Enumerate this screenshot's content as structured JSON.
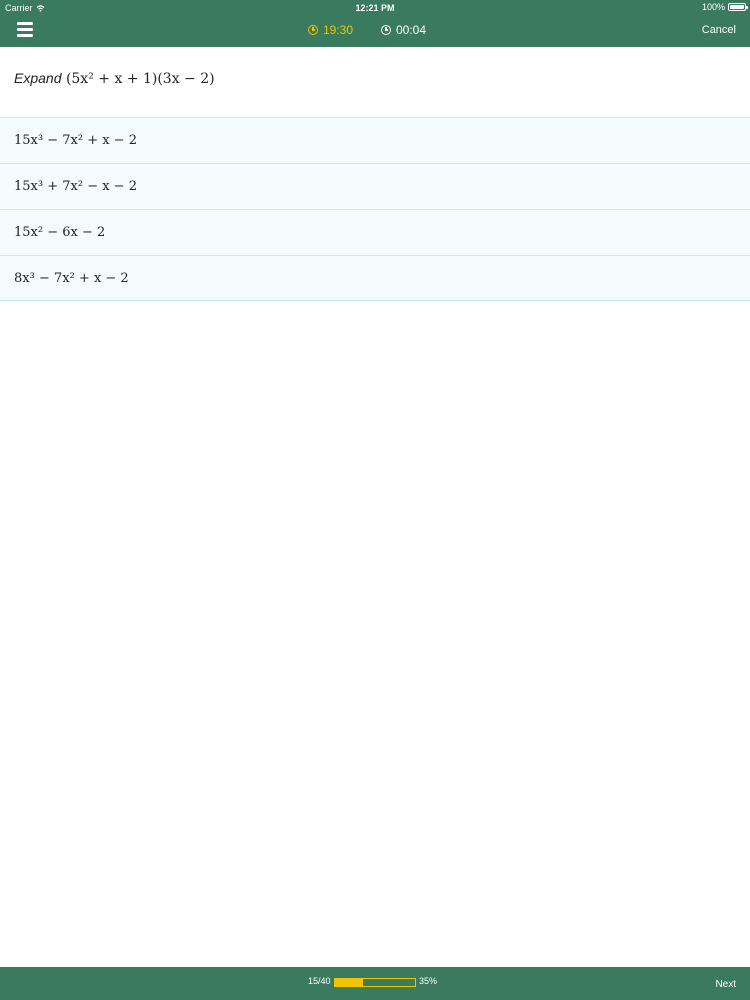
{
  "status_bar": {
    "carrier": "Carrier",
    "time": "12:21 PM",
    "battery": "100%"
  },
  "nav": {
    "menu_icon": "hamburger-menu-icon",
    "timer_remaining": "19:30",
    "timer_elapsed": "00:04",
    "cancel_label": "Cancel",
    "accent_color": "#f2c400",
    "bar_color": "#3a7a5f"
  },
  "question": {
    "label": "Expand",
    "expression": "(5x² + x + 1)(3x − 2)"
  },
  "answers": [
    {
      "expression": "15x³ − 7x² + x − 2"
    },
    {
      "expression": "15x³ + 7x² − x − 2"
    },
    {
      "expression": "15x² − 6x − 2"
    },
    {
      "expression": "8x³ − 7x² + x − 2"
    }
  ],
  "footer": {
    "question_count": "15/40",
    "progress_percent_label": "35%",
    "progress_fraction": 0.35,
    "next_label": "Next"
  }
}
